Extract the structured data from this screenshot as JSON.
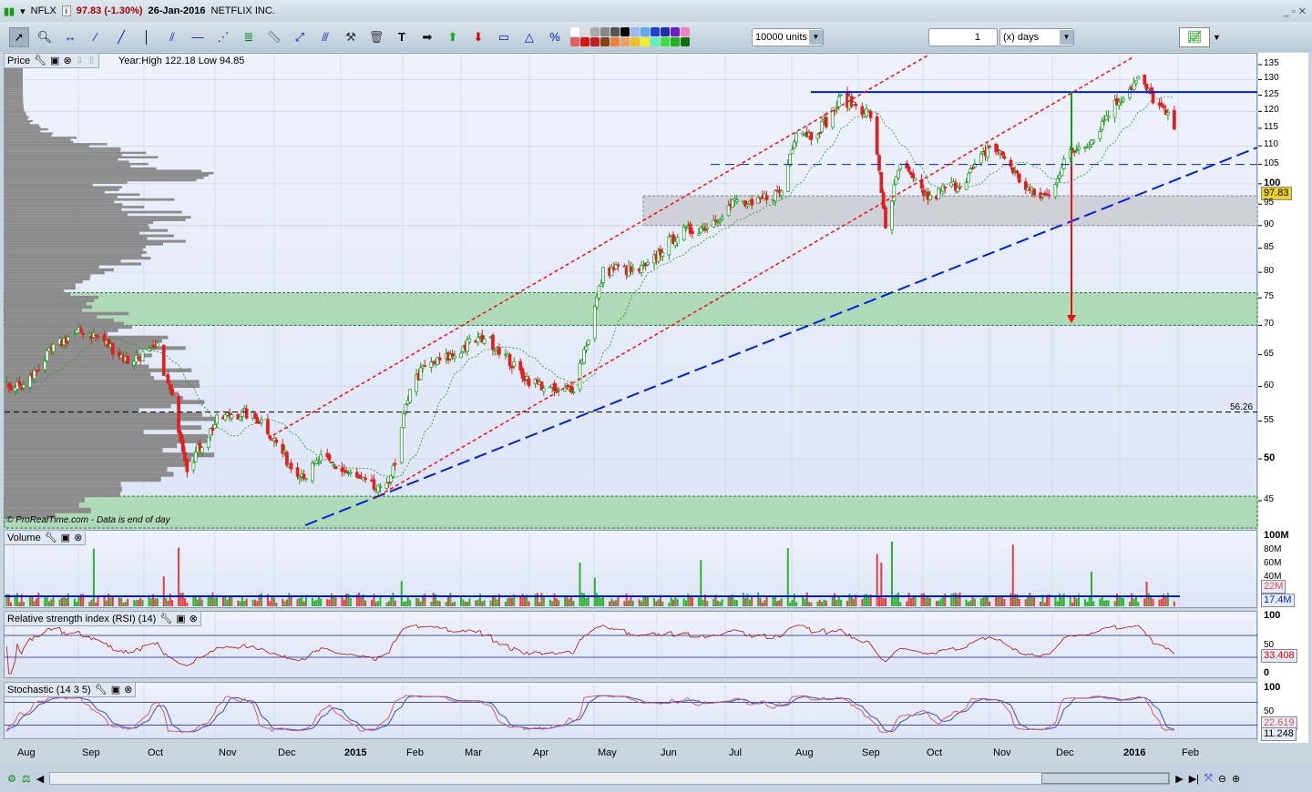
{
  "header": {
    "symbol": "NFLX",
    "price_change": "97.83 (-1.30%)",
    "date": "26-Jan-2016",
    "name": "NETFLIX INC."
  },
  "toolbar": {
    "units": "10000 units",
    "period_value": "1",
    "period_unit": "(x) days"
  },
  "price_panel": {
    "label": "Price",
    "year_info": "Year:High 122.18 Low 94.85",
    "watermark": "© ProRealTime.com - Data is end of day",
    "last_price": "97.83",
    "level_label": "56.26",
    "ticks": [
      "135",
      "130",
      "125",
      "120",
      "115",
      "110",
      "105",
      "100",
      "95",
      "90",
      "85",
      "80",
      "75",
      "70",
      "65",
      "60",
      "55",
      "50",
      "45"
    ]
  },
  "volume_panel": {
    "label": "Volume",
    "ticks": [
      "100M",
      "80M",
      "60M",
      "40M"
    ],
    "last_volume": "22M",
    "avg_volume": "17.4M"
  },
  "rsi_panel": {
    "label": "Relative strength index (RSI) (14)",
    "ticks": [
      "100",
      "50",
      "0"
    ],
    "value": "33.408"
  },
  "stoch_panel": {
    "label": "Stochastic (14 3 5)",
    "ticks": [
      "100",
      "50"
    ],
    "k_value": "22.619",
    "d_value": "11.248"
  },
  "x_axis": [
    "Aug",
    "Sep",
    "Oct",
    "Nov",
    "Dec",
    "2015",
    "Feb",
    "Mar",
    "Apr",
    "May",
    "Jun",
    "Jul",
    "Aug",
    "Sep",
    "Oct",
    "Nov",
    "Dec",
    "2016",
    "Feb"
  ],
  "colors": {
    "up": "#1a9a1a",
    "down": "#e02020",
    "support_zone": "#a8d8b0",
    "grey_zone": "#d0d0d8",
    "trend_blue": "#0020e0",
    "trend_red": "#f01010"
  },
  "chart_data": {
    "type": "candlestick",
    "start_week": "2014-08-01",
    "scale": "log",
    "ylim": [
      42,
      137
    ],
    "weekly_close": [
      60,
      63,
      66,
      68,
      69,
      68,
      66,
      64,
      65,
      66,
      58,
      49,
      52,
      55,
      56,
      56,
      55,
      52,
      49,
      48,
      50,
      49,
      48,
      47,
      46,
      49,
      60,
      63,
      64,
      65,
      67,
      68,
      66,
      63,
      61,
      60,
      59,
      60,
      68,
      80,
      81,
      80,
      81,
      85,
      88,
      89,
      90,
      93,
      96,
      94,
      97,
      98,
      115,
      113,
      117,
      124,
      122,
      119,
      90,
      105,
      100,
      96,
      99,
      100,
      104,
      110,
      107,
      101,
      97,
      97,
      106,
      110,
      112,
      120,
      125,
      130,
      124,
      118,
      112,
      110,
      104,
      98
    ],
    "resistance": 126,
    "support_zones": [
      [
        70,
        76
      ],
      [
        42,
        45.5
      ]
    ],
    "grey_zone": [
      90,
      97
    ],
    "dashed_levels": [
      105,
      56.26
    ]
  }
}
